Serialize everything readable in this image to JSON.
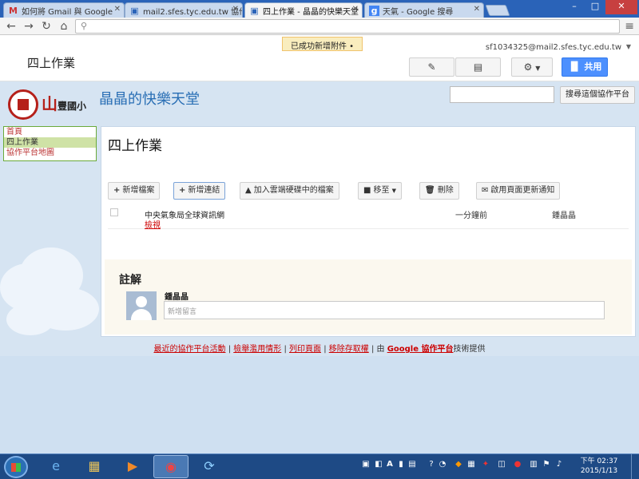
{
  "browser": {
    "tabs": [
      {
        "title": "如何將 Gmail 與 Google",
        "icon": "gmail-icon"
      },
      {
        "title": "mail2.sfes.tyc.edu.tw 協作",
        "icon": "sites-icon"
      },
      {
        "title": "四上作業 - 晶晶的快樂天堂",
        "icon": "sites-icon"
      },
      {
        "title": "天氣 - Google 搜尋",
        "icon": "google-icon"
      }
    ],
    "active_tab": 2,
    "url": ""
  },
  "sites_toolbar": {
    "toast": "已成功新增附件 •",
    "account": "sf1034325@mail2.sfes.tyc.edu.tw",
    "page_name": "四上作業",
    "share_label": "共用"
  },
  "site": {
    "school_name": "豐國小",
    "logo_mountain": "山",
    "title": "晶晶的快樂天堂",
    "search_placeholder": "",
    "search_button": "搜尋這個協作平台"
  },
  "sidebar": {
    "items": [
      "首頁",
      "四上作業",
      "協作平台地圖"
    ],
    "active": 1
  },
  "main": {
    "heading": "四上作業",
    "actions": [
      "新增檔案",
      "新增連結",
      "加入雲端硬碟中的檔案",
      "移至",
      "刪除",
      "啟用頁面更新通知"
    ],
    "files": [
      {
        "name": "中央氣象局全球資訊網",
        "link": "檢視",
        "time": "一分鐘前",
        "user": "鍾晶晶"
      }
    ],
    "comments_heading": "註解",
    "comment_author": "鍾晶晶",
    "comment_placeholder": "新增留言"
  },
  "footer": {
    "recent": "最近的協作平台活動",
    "abuse": "檢舉濫用情形",
    "print": "列印頁面",
    "remove": "移除存取權",
    "by": "由",
    "google_sites": "Google 協作平台",
    "provided": "技術提供"
  },
  "taskbar": {
    "time": "下午 02:37",
    "date": "2015/1/13"
  },
  "colors": {
    "tabstrip": "#2a63b8",
    "share_button": "#4d90fe",
    "site_title": "#2a6fb5",
    "sidebar_active": "#cfe2a6",
    "link_red": "#c00"
  }
}
